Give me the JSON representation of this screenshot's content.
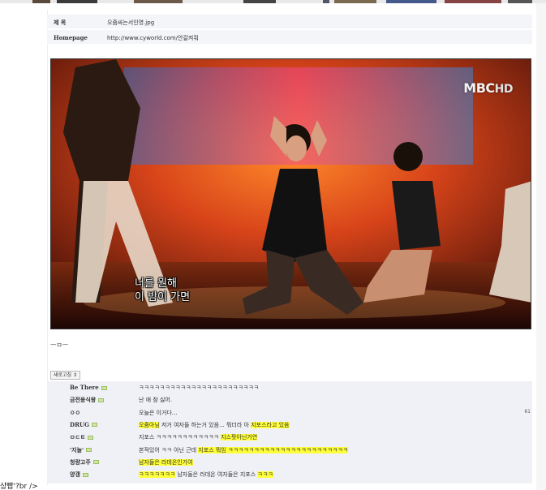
{
  "post": {
    "title_label": "제 목",
    "title_value": "오줌싸는서인영.jpg",
    "homepage_label": "Homepage",
    "homepage_value": "http://www.cyworld.com/안갈켜줘"
  },
  "image": {
    "logo_mbc": "MBC",
    "logo_hd": "HD",
    "subtitle_line1": "너를 원해",
    "subtitle_line2": "이 밤이 가면"
  },
  "caption": "ㅡㅁㅡ",
  "sort_button": "새로고침 ⇕",
  "comments": [
    {
      "name": "Be There",
      "serif": true,
      "icon": true,
      "segments": [
        {
          "t": "ㅋㅋㅋㅋㅋㅋㅋㅋㅋㅋㅋㅋㅋㅋㅋㅋㅋㅋㅋㅋㅋㅋㅋ",
          "hl": false
        }
      ],
      "num": ""
    },
    {
      "name": "금전용식왕",
      "serif": false,
      "icon": true,
      "segments": [
        {
          "t": "난 애 참 싫어.",
          "hl": false
        }
      ],
      "num": ""
    },
    {
      "name": "ㅇㅇ",
      "serif": false,
      "icon": false,
      "segments": [
        {
          "t": "오늘은 이거다...",
          "hl": false
        }
      ],
      "num": "61"
    },
    {
      "name": "DRUG",
      "serif": true,
      "icon": true,
      "segments": [
        {
          "t": "오줌아님",
          "hl": true
        },
        {
          "t": " 저거 여자들 하는거 있음... 뭐더라 아 ",
          "hl": false
        },
        {
          "t": "지포스라고 있음",
          "hl": true
        }
      ],
      "num": ""
    },
    {
      "name": "ㅁㄷㅌ",
      "serif": false,
      "icon": true,
      "segments": [
        {
          "t": "지포스 ㅋㅋㅋㅋㅋㅋㅋㅋㅋㅋㅋㅋ ",
          "hl": false
        },
        {
          "t": "지스팟아닌가연",
          "hl": true
        }
      ],
      "num": ""
    },
    {
      "name": "'지놀'",
      "serif": false,
      "icon": true,
      "segments": [
        {
          "t": "본적있어 ㅋㅋ 아닌 근데 ",
          "hl": false
        },
        {
          "t": "지포스 뭐임 ㅋㅋㅋㅋㅋㅋㅋㅋㅋㅋㅋㅋㅋㅋㅋㅋㅋㅋㅋㅋㅋㅋㅋ",
          "hl": true
        }
      ],
      "num": ""
    },
    {
      "name": "청량고주",
      "serif": false,
      "icon": true,
      "segments": [
        {
          "t": "남자들은 라데온인가여",
          "hl": true
        }
      ],
      "num": ""
    },
    {
      "name": "양갱",
      "serif": false,
      "icon": true,
      "segments": [
        {
          "t": "ㅋㅋㅋㅋㅋㅋㅋ",
          "hl": true
        },
        {
          "t": " 남자들은 라데온 여자들은 지포스 ",
          "hl": false
        },
        {
          "t": "ㅋㅋㅋ",
          "hl": true
        }
      ],
      "num": ""
    }
  ],
  "left_edge_text": "샹빱'?br />",
  "colors": {
    "highlight": "#ffff3a",
    "comment_bg": "#f0f1f6",
    "meta_bg": "#f4f5f9"
  }
}
